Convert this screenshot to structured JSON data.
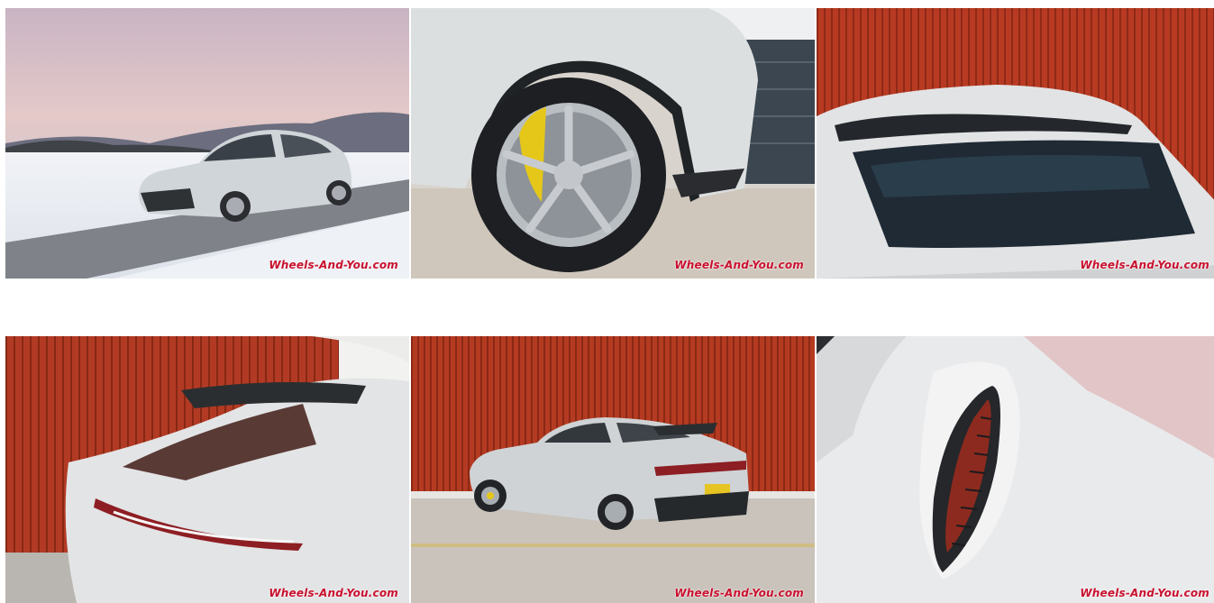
{
  "gallery": {
    "photos": [
      {
        "subject": "suv-front-three-quarter-snow",
        "watermark": "Wheels-And-You.com"
      },
      {
        "subject": "front-wheel-yellow-caliper",
        "watermark": "Wheels-And-You.com"
      },
      {
        "subject": "rear-window-spoiler",
        "watermark": "Wheels-And-You.com"
      },
      {
        "subject": "rear-spoiler-taillight-closeup",
        "watermark": "Wheels-And-You.com"
      },
      {
        "subject": "suv-rear-three-quarter-red-wall",
        "watermark": "Wheels-And-You.com"
      },
      {
        "subject": "hood-vent-closeup",
        "watermark": "Wheels-And-You.com"
      }
    ]
  },
  "colors": {
    "watermark_red": "#c8102e",
    "wall_red": "#b83a22",
    "car_silver": "#d8dcdd",
    "caliper_yellow": "#e5c71a"
  }
}
